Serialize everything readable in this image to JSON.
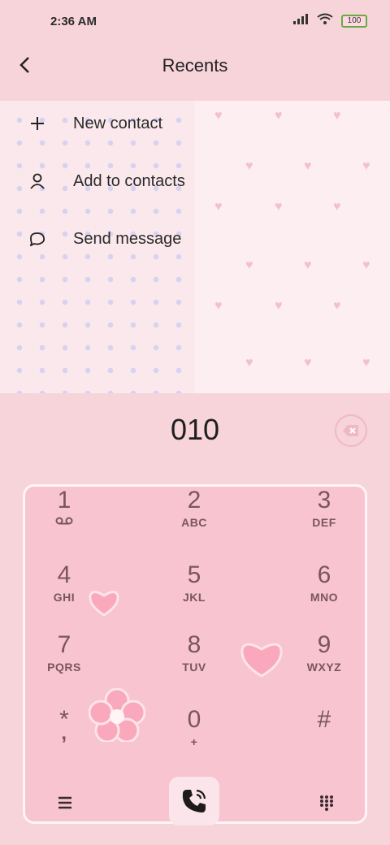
{
  "status": {
    "time": "2:36 AM",
    "battery": "100"
  },
  "header": {
    "title": "Recents"
  },
  "menu": {
    "items": [
      {
        "label": "New contact",
        "icon": "plus-icon"
      },
      {
        "label": "Add to contacts",
        "icon": "person-icon"
      },
      {
        "label": "Send message",
        "icon": "message-icon"
      }
    ]
  },
  "dialer": {
    "number": "010",
    "keys": [
      {
        "digit": "1",
        "letters": ""
      },
      {
        "digit": "2",
        "letters": "ABC"
      },
      {
        "digit": "3",
        "letters": "DEF"
      },
      {
        "digit": "4",
        "letters": "GHI"
      },
      {
        "digit": "5",
        "letters": "JKL"
      },
      {
        "digit": "6",
        "letters": "MNO"
      },
      {
        "digit": "7",
        "letters": "PQRS"
      },
      {
        "digit": "8",
        "letters": "TUV"
      },
      {
        "digit": "9",
        "letters": "WXYZ"
      },
      {
        "digit": "*",
        "letters": ","
      },
      {
        "digit": "0",
        "letters": "+"
      },
      {
        "digit": "#",
        "letters": ""
      }
    ]
  },
  "colors": {
    "background": "#f7d3da",
    "keypad": "#f7c4cf",
    "key_text": "#7a5560"
  }
}
